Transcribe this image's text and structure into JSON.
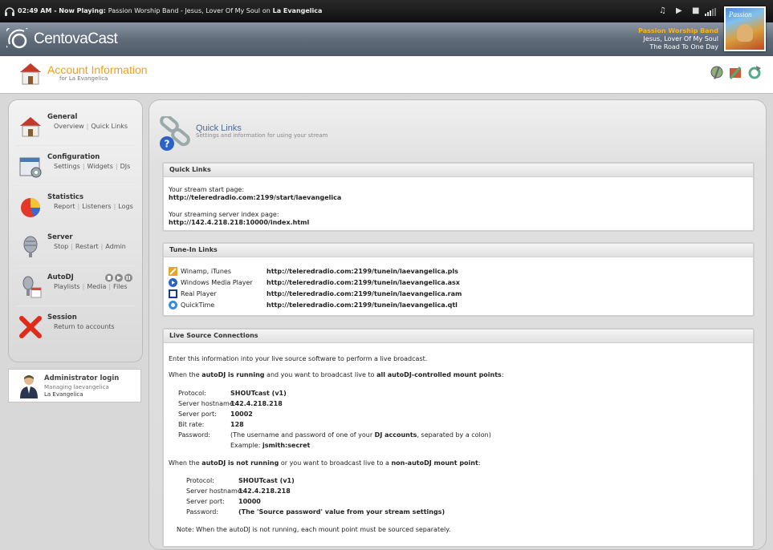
{
  "now_playing": {
    "time": "02:49 AM",
    "label": "Now Playing:",
    "song": "Passion Worship Band - Jesus, Lover Of My Soul",
    "on_word": "on",
    "station": "La Evangelica",
    "controls": [
      "music-note-icon",
      "play-icon",
      "stop-icon",
      "volume-icon"
    ]
  },
  "header": {
    "logo": "CentovaCast",
    "track_artist": "Passion Worship Band",
    "track_title": "Jesus, Lover Of My Soul",
    "track_album": "The Road To One Day",
    "album_art_text": "Passion",
    "toolbar_icons": [
      "dj-icon",
      "tools-icon",
      "refresh-icon"
    ]
  },
  "account": {
    "title": "Account Information",
    "subtitle": "for La Evangelica"
  },
  "sidebar": {
    "items": [
      {
        "title": "General",
        "links": [
          "Overview",
          "Quick Links"
        ]
      },
      {
        "title": "Configuration",
        "links": [
          "Settings",
          "Widgets",
          "DJs"
        ]
      },
      {
        "title": "Statistics",
        "links": [
          "Report",
          "Listeners",
          "Logs"
        ]
      },
      {
        "title": "Server",
        "links": [
          "Stop",
          "Restart",
          "Admin"
        ]
      },
      {
        "title": "AutoDJ",
        "links": [
          "Playlists",
          "Media",
          "Files"
        ]
      },
      {
        "title": "Session",
        "links": [
          "Return to accounts"
        ]
      }
    ],
    "admin": {
      "title": "Administrator login",
      "line1": "Managing laevangelica",
      "line2": "La Evangelica"
    }
  },
  "main": {
    "title": "Quick Links",
    "subtitle": "Settings and information for using your stream",
    "quick_links": {
      "header": "Quick Links",
      "start_label": "Your stream start page:",
      "start_url": "http://teleredradio.com:2199/start/laevangelica",
      "index_label": "Your streaming server index page:",
      "index_url": "http://142.4.218.218:10000/index.html"
    },
    "tunein": {
      "header": "Tune-In Links",
      "rows": [
        {
          "player": "Winamp, iTunes",
          "url": "http://teleredradio.com:2199/tunein/laevangelica.pls",
          "icon": "winamp-icon"
        },
        {
          "player": "Windows Media Player",
          "url": "http://teleredradio.com:2199/tunein/laevangelica.asx",
          "icon": "wmp-icon"
        },
        {
          "player": "Real Player",
          "url": "http://teleredradio.com:2199/tunein/laevangelica.ram",
          "icon": "real-icon"
        },
        {
          "player": "QuickTime",
          "url": "http://teleredradio.com:2199/tunein/laevangelica.qtl",
          "icon": "quicktime-icon"
        }
      ]
    },
    "live": {
      "header": "Live Source Connections",
      "intro": "Enter this information into your live source software to perform a live broadcast.",
      "running_pre": "When the ",
      "running_b1": "autoDJ is running",
      "running_mid": " and you want to broadcast live to ",
      "running_b2": "all autoDJ-controlled mount points",
      "running_post": ":",
      "running_fields": [
        {
          "label": "Protocol:",
          "value": "SHOUTcast (v1)"
        },
        {
          "label": "Server hostname:",
          "value": "142.4.218.218"
        },
        {
          "label": "Server port:",
          "value": "10002"
        },
        {
          "label": "Bit rate:",
          "value": "128"
        }
      ],
      "password_label": "Password:",
      "password_pre": "(The username and password of one of your ",
      "password_b": "DJ accounts",
      "password_post": ", separated by a colon)",
      "example_label": "Example:",
      "example_value": "jsmith:secret",
      "notrunning_pre": "When the ",
      "notrunning_b1": "autoDJ is not running",
      "notrunning_mid": " or you want to broadcast live to a ",
      "notrunning_b2": "non-autoDJ mount point",
      "notrunning_post": ":",
      "notrunning_fields": [
        {
          "label": "Protocol:",
          "value": "SHOUTcast (v1)"
        },
        {
          "label": "Server hostname:",
          "value": "142.4.218.218"
        },
        {
          "label": "Server port:",
          "value": "10000"
        },
        {
          "label": "Password:",
          "value": "(The 'Source password' value from your stream settings)"
        }
      ],
      "note": "Note: When the autoDJ is not running, each mount point must be sourced separately."
    }
  }
}
